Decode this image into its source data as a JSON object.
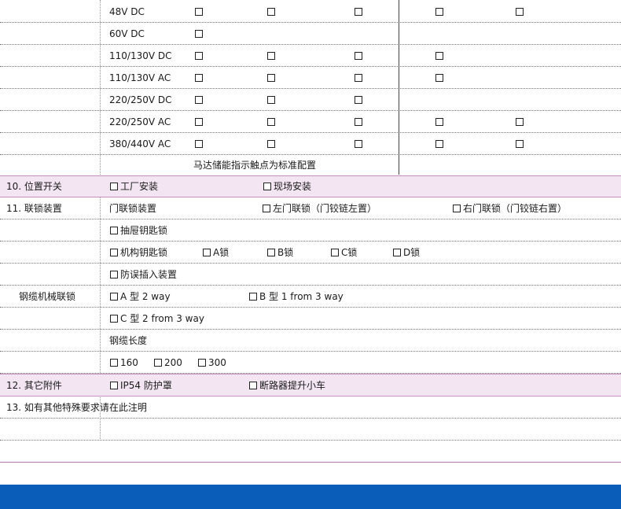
{
  "voltage_rows": [
    {
      "label": "48V DC"
    },
    {
      "label": "60V DC"
    },
    {
      "label": "110/130V DC"
    },
    {
      "label": "110/130V AC"
    },
    {
      "label": "220/250V DC"
    },
    {
      "label": "220/250V AC"
    },
    {
      "label": "380/440V AC"
    }
  ],
  "motor_note": "马达储能指示触点为标准配置",
  "position_switch": {
    "label": "10. 位置开关",
    "opt1": "工厂安装",
    "opt2": "现场安装"
  },
  "interlock": {
    "label": "11. 联锁装置",
    "door_interlock": "门联锁装置",
    "left_door": "左门联锁（门铰链左置）",
    "right_door": "右门联锁（门铰链右置）",
    "drawer_key": "抽屉钥匙锁",
    "mech_key": "机构钥匙锁",
    "lock_a": "A锁",
    "lock_b": "B锁",
    "lock_c": "C锁",
    "lock_d": "D锁",
    "anti_misinsert": "防误插入装置"
  },
  "cable_interlock": {
    "label": "钢缆机械联锁",
    "type_a": "A 型 2 way",
    "type_b": "B 型 1 from 3 way",
    "type_c": "C 型 2 from 3 way",
    "length_label": "钢缆长度",
    "len_160": "160",
    "len_200": "200",
    "len_300": "300"
  },
  "accessories": {
    "label": "12. 其它附件",
    "ip54": "IP54 防护罩",
    "lift_trolley": "断路器提升小车"
  },
  "special": {
    "label": "13. 如有其他特殊要求请在此注明"
  },
  "colors": {
    "section_bg": "#f3e6f2",
    "footer_bar": "#0a5db8"
  }
}
